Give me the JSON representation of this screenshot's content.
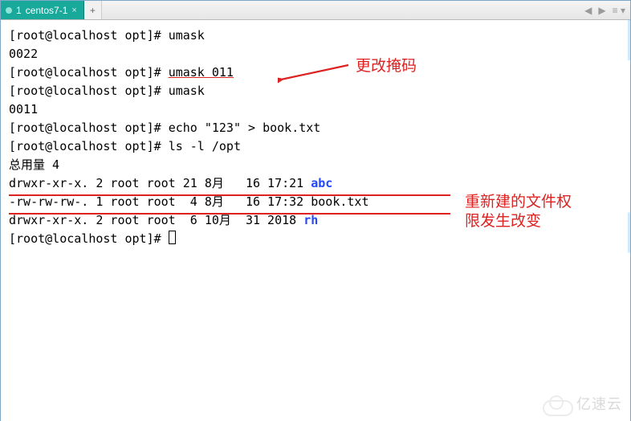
{
  "tab": {
    "index": "1",
    "title": "centos7-1",
    "close": "×"
  },
  "newtab": "+",
  "nav": {
    "back": "◀",
    "fwd": "▶",
    "menu": "≡ ▾"
  },
  "prompt": "[root@localhost opt]# ",
  "cmd": {
    "umask1": "umask",
    "out1": "0022",
    "umask_set": "umask 011",
    "umask2": "umask",
    "out2": "0011",
    "echo": "echo \"123\" > book.txt",
    "ls": "ls -l /opt"
  },
  "ls_header": "总用量 4",
  "ls_rows": [
    {
      "perm": "drwxr-xr-x.",
      "n": "2",
      "u": "root",
      "g": "root",
      "sz": "21",
      "mo": "8月",
      "d": "16",
      "tm": "17:21",
      "name": "abc",
      "dir": true
    },
    {
      "perm": "-rw-rw-rw-.",
      "n": "1",
      "u": "root",
      "g": "root",
      "sz": " 4",
      "mo": "8月",
      "d": "16",
      "tm": "17:32",
      "name": "book.txt",
      "dir": false
    },
    {
      "perm": "drwxr-xr-x.",
      "n": "2",
      "u": "root",
      "g": "root",
      "sz": " 6",
      "mo": "10月",
      "d": "31",
      "tm": "2018",
      "name": "rh",
      "dir": true
    }
  ],
  "annot": {
    "a1": "更改掩码",
    "a2a": "重新建的文件权",
    "a2b": "限发生改变"
  },
  "watermark": "亿速云"
}
